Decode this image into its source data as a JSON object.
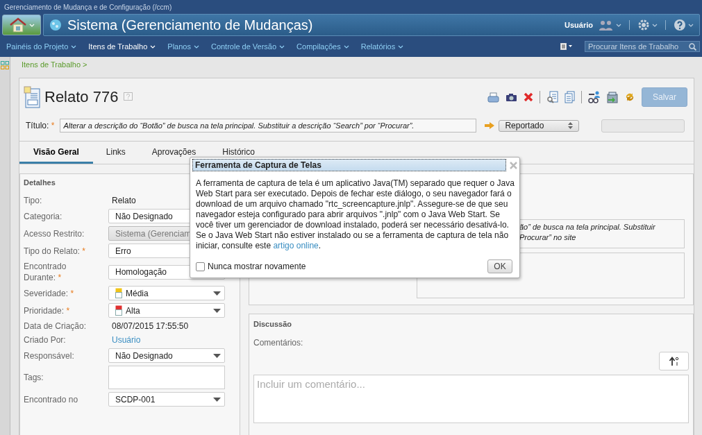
{
  "app_title": "Gerenciamento de Mudança e de Configuração (/ccm)",
  "project_title": "Sistema (Gerenciamento de Mudanças)",
  "user_menu": "Usuário",
  "nav": [
    {
      "label": "Painéis do Projeto",
      "selected": false
    },
    {
      "label": "Itens de Trabalho",
      "selected": true
    },
    {
      "label": "Planos",
      "selected": false
    },
    {
      "label": "Controle de Versão",
      "selected": false
    },
    {
      "label": "Compilações",
      "selected": false
    },
    {
      "label": "Relatórios",
      "selected": false
    }
  ],
  "search": {
    "placeholder": "Procurar Itens de Trabalho"
  },
  "breadcrumb": "Itens de Trabalho >",
  "work_item": {
    "title": "Relato 776",
    "save": {
      "label": "Salvar",
      "disabled": true
    },
    "summary_label": "Título:",
    "required_mark": "*",
    "summary": "Alterar a descrição do “Botão” de busca na tela principal. Substituir a descrição “Search” por “Procurar”.",
    "state": "Reportado"
  },
  "tabs": [
    {
      "label": "Visão Geral",
      "selected": true
    },
    {
      "label": "Links",
      "selected": false
    },
    {
      "label": "Aprovações",
      "selected": false
    },
    {
      "label": "Histórico",
      "selected": false
    }
  ],
  "details": {
    "heading": "Detalhes",
    "fields": [
      {
        "label": "Tipo:",
        "required": false,
        "kind": "text",
        "value": "Relato"
      },
      {
        "label": "Categoria:",
        "required": false,
        "kind": "select",
        "value": "Não Designado"
      },
      {
        "label": "Acesso Restrito:",
        "required": false,
        "kind": "select",
        "disabled": true,
        "value": "Sistema (Gerenciam"
      },
      {
        "label": "Tipo do Relato:",
        "required": true,
        "kind": "select",
        "value": "Erro"
      },
      {
        "label": "Encontrado Durante:",
        "required": true,
        "kind": "select",
        "value": "Homologação"
      },
      {
        "label": "Severidade:",
        "required": true,
        "kind": "select",
        "color": "#f0c419",
        "value": "Média"
      },
      {
        "label": "Prioridade:",
        "required": true,
        "kind": "select",
        "color": "#e03030",
        "value": "Alta"
      },
      {
        "label": "Data de Criação:",
        "required": false,
        "kind": "text",
        "value": "08/07/2015 17:55:50"
      },
      {
        "label": "Criado Por:",
        "required": false,
        "kind": "link",
        "value": "Usuário"
      },
      {
        "label": "Responsável:",
        "required": false,
        "kind": "select",
        "value": "Não Designado"
      },
      {
        "label": "Tags:",
        "required": false,
        "kind": "textarea"
      },
      {
        "label": "Encontrado no",
        "required": false,
        "kind": "select",
        "value": "SCDP-001"
      }
    ]
  },
  "description": {
    "lines": [
      "ão” de busca na tela principal. Substituir",
      "Procurar” no site"
    ]
  },
  "discussion": {
    "heading": "Discussão",
    "comments_label": "Comentários:",
    "placeholder": "Incluir um comentário..."
  },
  "dialog": {
    "title": "Ferramenta de Captura de Telas",
    "body_before": "A ferramenta de captura de tela é um aplicativo Java(TM) separado que requer o Java Web Start para ser executado. Depois de fechar este diálogo, o seu navegador fará o download de um arquivo chamado \"rtc_screencapture.jnlp\". Assegure-se de que seu navegador esteja configurado para abrir arquivos \".jnlp\" com o Java Web Start. Se você tiver um gerenciador de download instalado, poderá ser necessário desativá-lo. Se o Java Web Start não estiver instalado ou se a ferramenta de captura de tela não iniciar, consulte este ",
    "link": "artigo online",
    "body_after": ".",
    "checkbox": {
      "label": "Nunca mostrar novamente",
      "checked": false
    },
    "ok": "OK"
  }
}
